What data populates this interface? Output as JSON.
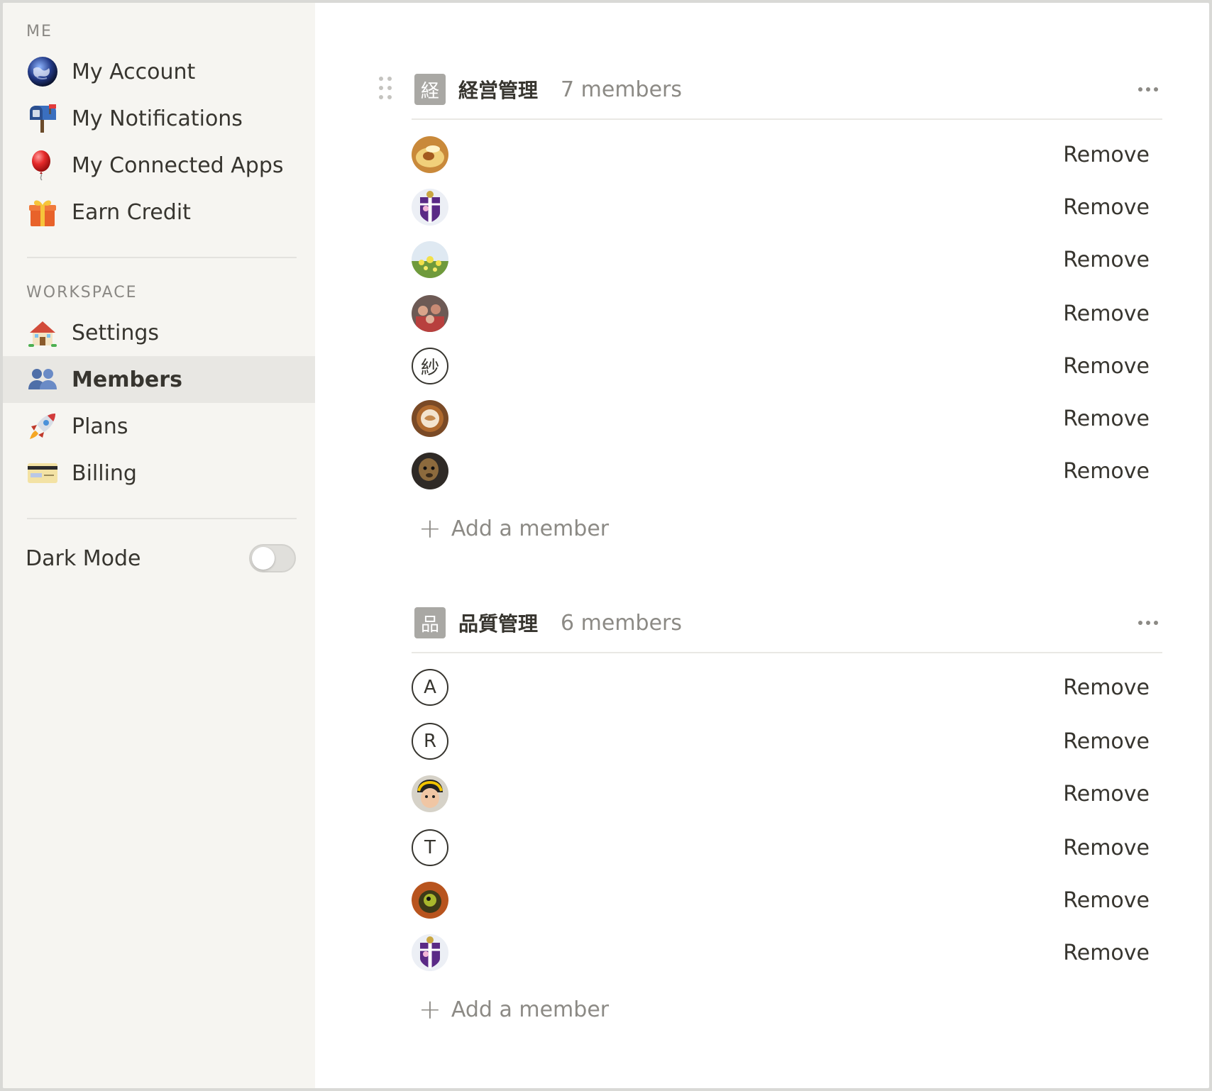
{
  "sidebar": {
    "me_label": "ME",
    "me_items": [
      {
        "label": "My Account",
        "icon": "earth-icon"
      },
      {
        "label": "My Notifications",
        "icon": "mailbox-icon"
      },
      {
        "label": "My Connected Apps",
        "icon": "balloon-icon"
      },
      {
        "label": "Earn Credit",
        "icon": "gift-icon"
      }
    ],
    "workspace_label": "WORKSPACE",
    "workspace_items": [
      {
        "label": "Settings",
        "icon": "house-icon"
      },
      {
        "label": "Members",
        "icon": "people-icon",
        "active": true
      },
      {
        "label": "Plans",
        "icon": "rocket-icon"
      },
      {
        "label": "Billing",
        "icon": "credit-card-icon"
      }
    ],
    "dark_mode_label": "Dark Mode",
    "dark_mode_on": false
  },
  "groups": [
    {
      "icon_char": "経",
      "name": "経営管理",
      "count": "7 members",
      "members": [
        {
          "avatar": "photo"
        },
        {
          "avatar": "photo"
        },
        {
          "avatar": "photo"
        },
        {
          "avatar": "photo"
        },
        {
          "avatar": "letter",
          "letter": "紗"
        },
        {
          "avatar": "photo"
        },
        {
          "avatar": "photo"
        }
      ]
    },
    {
      "icon_char": "品",
      "name": "品質管理",
      "count": "6 members",
      "members": [
        {
          "avatar": "letter",
          "letter": "A"
        },
        {
          "avatar": "letter",
          "letter": "R"
        },
        {
          "avatar": "photo"
        },
        {
          "avatar": "letter",
          "letter": "T"
        },
        {
          "avatar": "photo"
        },
        {
          "avatar": "photo"
        }
      ]
    }
  ],
  "remove_label": "Remove",
  "add_member_label": "Add a member",
  "add_member_plus": "+"
}
